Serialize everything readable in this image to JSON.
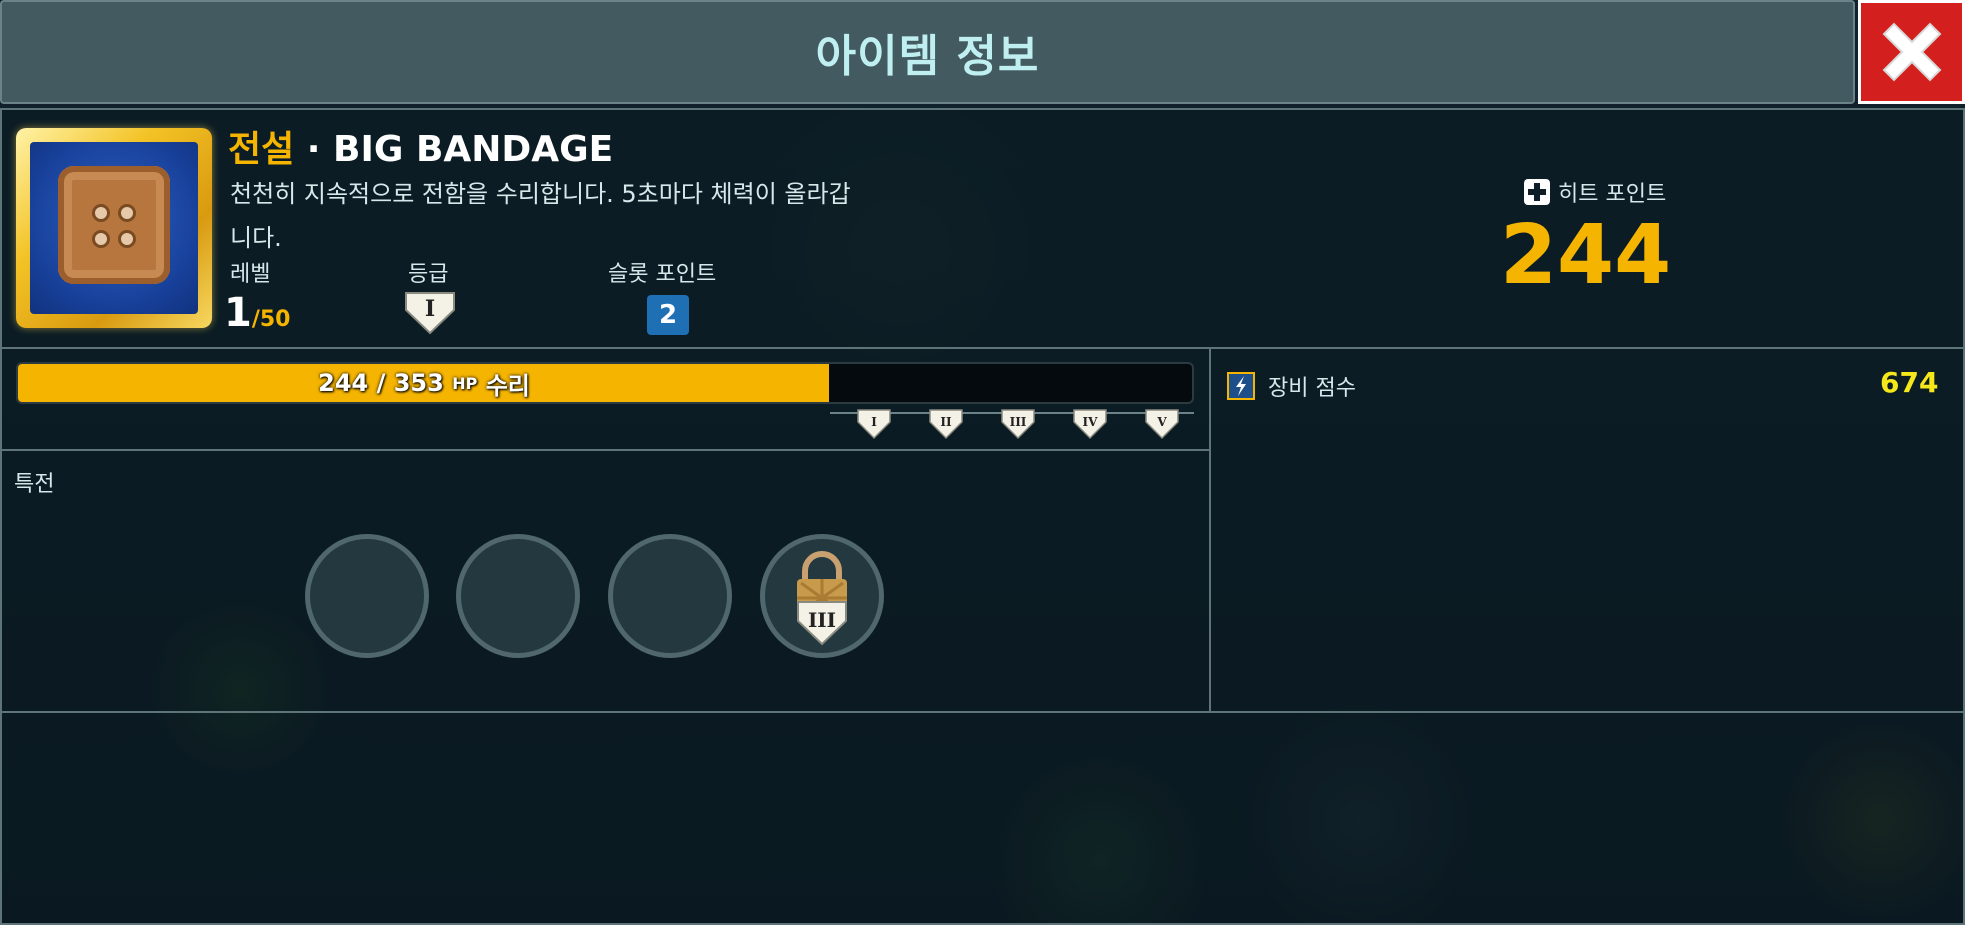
{
  "header": {
    "title": "아이템 정보",
    "close_icon": "close-icon"
  },
  "item": {
    "rarity": "전설",
    "separator": "·",
    "name": "BIG BANDAGE",
    "description": "천천히 지속적으로 전함을 수리합니다. 5초마다 체력이 올라갑니다.",
    "level_label": "레벨",
    "level_value": "1",
    "level_max": "/50",
    "grade_label": "등급",
    "grade_value": "I",
    "slot_label": "슬롯 포인트",
    "slot_value": "2"
  },
  "hit_points": {
    "label": "히트 포인트",
    "value": "244",
    "icon": "plus-cross-icon"
  },
  "repair_bar": {
    "current": "244",
    "sep": " / ",
    "max": "353",
    "unit": "HP",
    "action": "수리",
    "progress": 0.691,
    "fill_color": "#f5b400",
    "tiers": [
      "I",
      "II",
      "III",
      "IV",
      "V"
    ]
  },
  "equipment_score": {
    "label": "장비 점수",
    "value": "674",
    "icon": "lightning-icon"
  },
  "perks": {
    "label": "특전",
    "slots": [
      {
        "state": "empty"
      },
      {
        "state": "empty"
      },
      {
        "state": "empty"
      },
      {
        "state": "locked",
        "unlock_grade": "III"
      }
    ]
  }
}
